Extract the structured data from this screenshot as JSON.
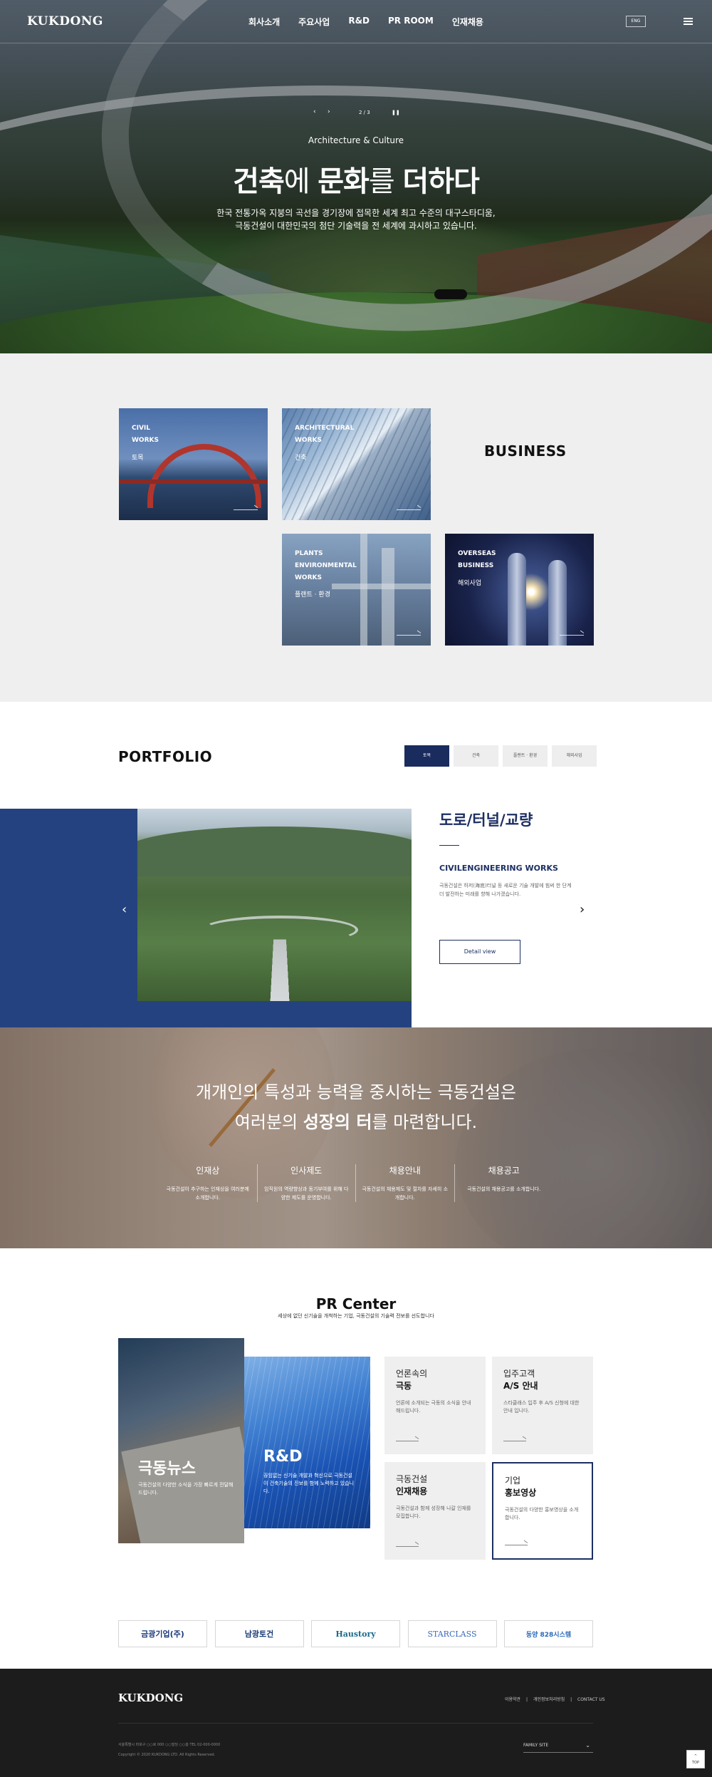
{
  "header": {
    "logo": "KUKDONG",
    "nav": [
      "회사소개",
      "주요사업",
      "R&D",
      "PR ROOM",
      "인재채용"
    ],
    "lang": "ENG"
  },
  "hero": {
    "slider_counter": "2 / 3",
    "subtitle": "Architecture & Culture",
    "title": {
      "w1": "건축",
      "w2": "에 ",
      "w3": "문화",
      "w4": "를 ",
      "w5": "더하다"
    },
    "desc_line1": "한국 전통가옥 지붕의 곡선을 경기장에 접목한 세계 최고 수준의 대구스타디움,",
    "desc_line2": "극동건설이 대한민국의 첨단 기술력을 전 세계에 과시하고 있습니다."
  },
  "business": {
    "title": "BUSINESS",
    "cards": [
      {
        "en1": "CIVIL",
        "en2": "WORKS",
        "en3": "",
        "kor": "토목"
      },
      {
        "en1": "ARCHITECTURAL",
        "en2": "WORKS",
        "en3": "",
        "kor": "건축"
      },
      {
        "en1": "PLANTS",
        "en2": "ENVIRONMENTAL",
        "en3": "WORKS",
        "kor": "플랜트 · 환경"
      },
      {
        "en1": "OVERSEAS",
        "en2": "BUSINESS",
        "en3": "",
        "kor": "해외사업"
      }
    ]
  },
  "portfolio": {
    "title": "PORTFOLIO",
    "tabs": [
      "토목",
      "건축",
      "플랜트 · 환경",
      "해외사업"
    ],
    "active_tab": 0,
    "item": {
      "name": "도로/터널/교량",
      "en": "CIVILENGINEERING WORKS",
      "desc": "극동건설은 하저(海底)터널 등 새로운 기술 개발에 힘써 한 단계 더 발전하는 미래를 향해 나가겠습니다.",
      "button": "Detail view"
    }
  },
  "recruit": {
    "line1": "개개인의 특성과 능력을 중시하는 극동건설은",
    "line2a": "여러분의 ",
    "line2b": "성장의 터",
    "line2c": "를 마련합니다.",
    "items": [
      {
        "title": "인재상",
        "desc": "극동건설이 추구하는 인재상을 여러분께 소개합니다."
      },
      {
        "title": "인사제도",
        "desc": "임직원의 역량향상과 동기부여를 위해 다양한 제도를 운영합니다."
      },
      {
        "title": "채용안내",
        "desc": "극동건설의 채용제도 및 절차를 자세히 소개합니다."
      },
      {
        "title": "채용공고",
        "desc": "극동건설의 채용공고를 소개합니다."
      }
    ]
  },
  "pr": {
    "title": "PR Center",
    "subtitle": "세상에 없던 신기술을 개척하는 기업, 극동건설의 기술력 전보를 선도합니다",
    "news": {
      "title": "극동뉴스",
      "desc": "극동건설의 다양한 소식을 가장 빠르게 전달해 드립니다."
    },
    "rnd": {
      "title": "R&D",
      "desc": "끊임없는 신기술 개발과 혁신으로 극동건설이 건축기술의 진보를 함께 노력하고 있습니다."
    },
    "cards": [
      {
        "k1": "언론속의",
        "k2": "극동",
        "desc": "언론에 소개되는 극동의 소식을 안내해드립니다."
      },
      {
        "k1": "입주고객",
        "k2": "A/S 안내",
        "desc": "스타클래스 입주 후 A/S 신청에 대한 안내 입니다."
      },
      {
        "k1": "극동건설",
        "k2": "인재채용",
        "desc": "극동건설과 함께 성장해 나갈 인재를 모집합니다."
      },
      {
        "k1": "기업",
        "k2": "홍보영상",
        "desc": "극동건설의 다양한 홍보영상을 소개합니다."
      }
    ]
  },
  "partners": [
    "금광기업(주)",
    "남광토건",
    "Haustory",
    "STARCLASS",
    "동양 828시스템"
  ],
  "footer": {
    "logo": "KUKDONG",
    "links": [
      "이용약관",
      "개인정보처리방침",
      "CONTACT US"
    ],
    "address": "서울특별시 마포구 ○○로 000 ○○빌딩 ○○층 TEL 02-000-0000",
    "copyright": "Copyright © 2020 KUKDONG LTD. All Rights Reserved.",
    "family_site": "FAMILY SITE",
    "top": "TOP"
  },
  "colors": {
    "navy": "#1a2b5e",
    "portfolio_blue": "#24427f",
    "footer_bg": "#1c1c1c",
    "business_bg": "#efefef"
  }
}
